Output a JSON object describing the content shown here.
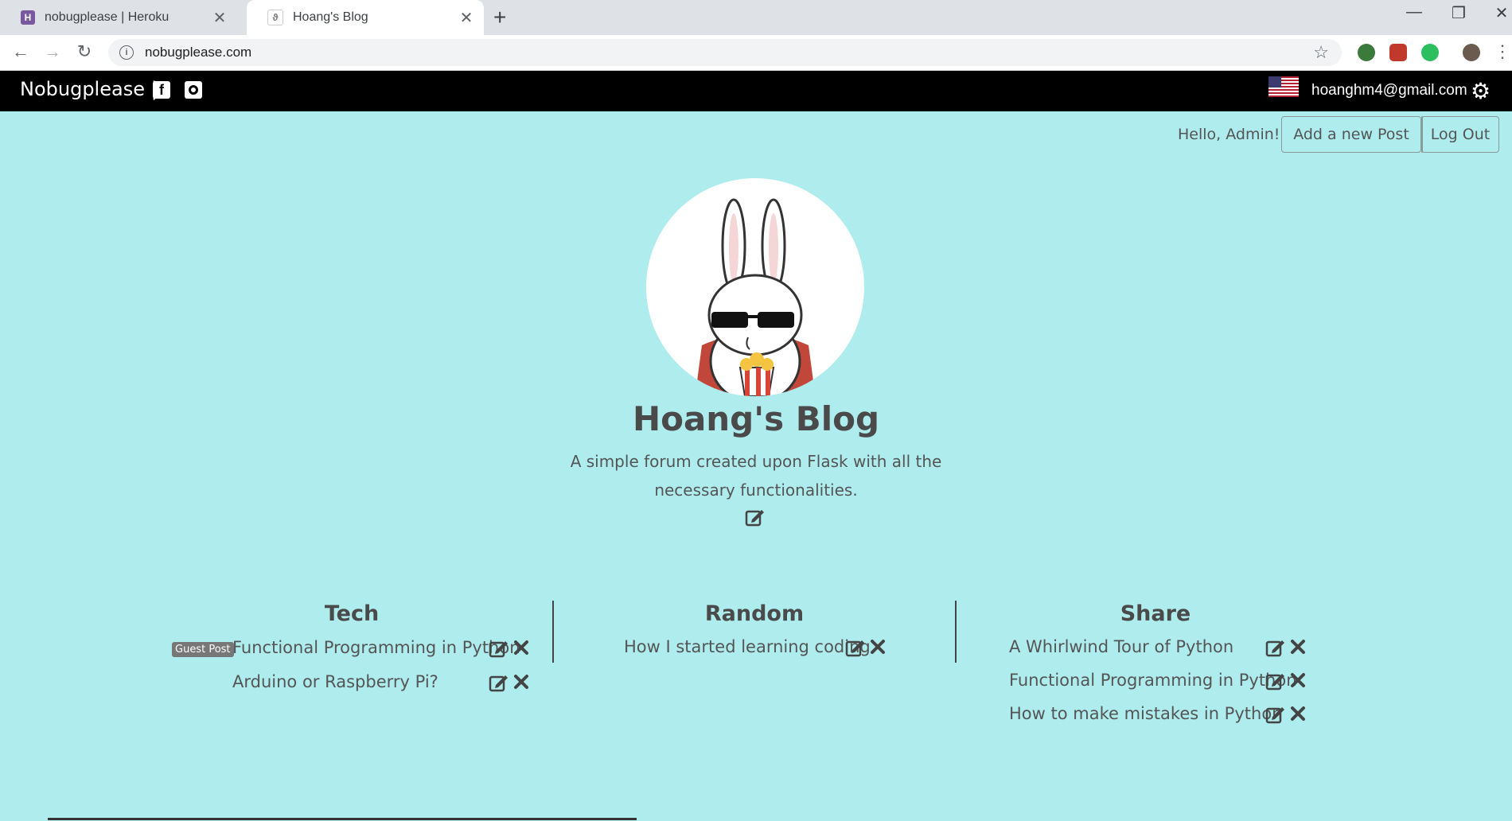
{
  "browser": {
    "tabs": [
      {
        "title": "nobugplease | Heroku",
        "favicon": "heroku-icon",
        "active": false
      },
      {
        "title": "Hoang's Blog",
        "favicon": "rabbit-icon",
        "active": true
      }
    ],
    "url": "nobugplease.com"
  },
  "navbar": {
    "brand": "Nobugplease |",
    "email": "hoanghm4@gmail.com"
  },
  "user_bar": {
    "greeting": "Hello, Admin!",
    "add_post_label": "Add a new Post",
    "logout_label": "Log Out"
  },
  "blog": {
    "title": "Hoang's Blog",
    "description": "A simple forum created upon Flask with all the necessary functionalities."
  },
  "categories": [
    {
      "name": "Tech",
      "posts": [
        {
          "title": "Functional Programming in Python",
          "badge": "Guest Post"
        },
        {
          "title": "Arduino or Raspberry Pi?"
        }
      ]
    },
    {
      "name": "Random",
      "posts": [
        {
          "title": "How I started learning coding."
        }
      ]
    },
    {
      "name": "Share",
      "posts": [
        {
          "title": "A Whirlwind Tour of Python"
        },
        {
          "title": "Functional Programming in Python"
        },
        {
          "title": "How to make mistakes in Python"
        }
      ]
    }
  ],
  "colors": {
    "page_bg": "#aeeced",
    "navbar_bg": "#000000",
    "text": "#555555"
  }
}
